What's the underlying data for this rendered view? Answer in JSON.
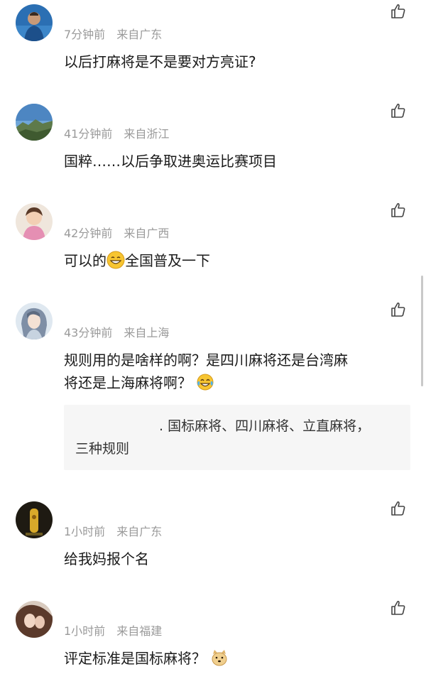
{
  "comments": [
    {
      "time": "7分钟前",
      "location": "来自广东",
      "text": "以后打麻将是不是要对方亮证?"
    },
    {
      "time": "41分钟前",
      "location": "来自浙江",
      "text": "国粹……以后争取进奥运比赛项目"
    },
    {
      "time": "42分钟前",
      "location": "来自广西",
      "text_before": "可以的",
      "emoji": "grinning-face-emoji",
      "text_after": "全国普及一下"
    },
    {
      "time": "43分钟前",
      "location": "来自上海",
      "text_line1": "规则用的是啥样的啊？是四川麻将还是台湾麻",
      "text_line2": "将还是上海麻将啊？",
      "emoji": "tears-of-joy-emoji",
      "reply": {
        "text_line1": ". 国标麻将、四川麻将、立直麻将，",
        "text_line2": "三种规则"
      }
    },
    {
      "time": "1小时前",
      "location": "来自广东",
      "text": "给我妈报个名"
    },
    {
      "time": "1小时前",
      "location": "来自福建",
      "text": "评定标准是国标麻将？",
      "emoji": "doge-emoji"
    }
  ],
  "icons": {
    "like": "thumbs-up-icon"
  },
  "colors": {
    "meta": "#9a9a9a",
    "text": "#1a1a1a",
    "reply_bg": "#f6f6f6"
  }
}
